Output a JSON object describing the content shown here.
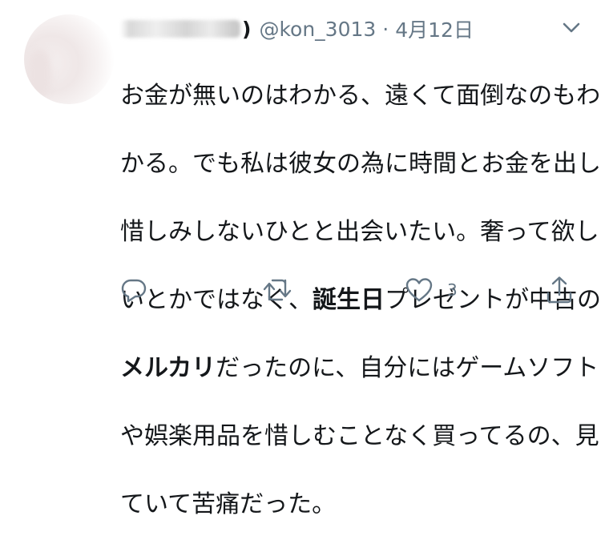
{
  "tweet": {
    "display_name_suffix": ")",
    "handle": "@kon_3013",
    "separator": "·",
    "date": "4月12日",
    "body_lines": [
      [
        "お金が無いのはわかる、遠くて面倒なのもわ"
      ],
      [
        "かる。でも私は彼女の為に時間とお金を出し"
      ],
      [
        "惜しみしないひとと出会いたい。奢って欲し"
      ],
      [
        "いとかではなく、",
        "誕生日",
        "プレゼントが中古の"
      ],
      [
        "メルカリ",
        "だったのに、自分にはゲームソフト"
      ],
      [
        "や娯楽用品を惜しむことなく買ってるの、見"
      ],
      [
        "ていて苦痛だった。"
      ]
    ],
    "like_count": "3"
  },
  "icons": {
    "reply": "reply-icon",
    "retweet": "retweet-icon",
    "like": "heart-icon",
    "share": "share-icon",
    "caret": "chevron-down-icon"
  },
  "colors": {
    "text": "#14171a",
    "secondary": "#657786"
  }
}
